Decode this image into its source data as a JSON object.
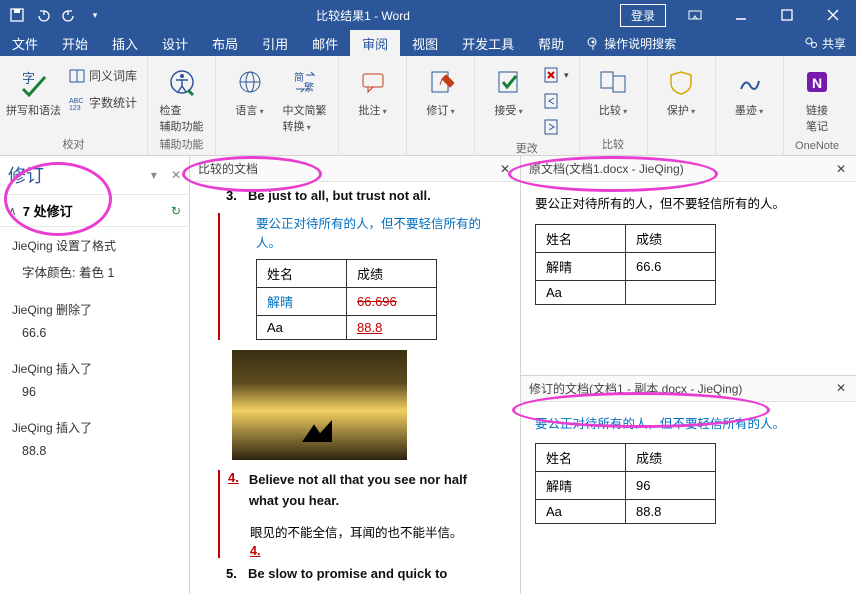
{
  "titlebar": {
    "title": "比较结果1 - Word",
    "login": "登录"
  },
  "menu": {
    "file": "文件",
    "home": "开始",
    "insert": "插入",
    "design": "设计",
    "layout": "布局",
    "references": "引用",
    "mailings": "邮件",
    "review": "审阅",
    "view": "视图",
    "developer": "开发工具",
    "help": "帮助",
    "tellme": "操作说明搜索",
    "share": "共享"
  },
  "ribbon": {
    "proofing": {
      "spell": "拼写和语法",
      "thesaurus": "同义词库",
      "wordcount": "字数统计",
      "label": "校对"
    },
    "accessibility": {
      "check": "检查\n辅助功能",
      "label": "辅助功能"
    },
    "language": {
      "lang": "语言",
      "convert": "中文简繁\n转换",
      "label": ""
    },
    "comments": {
      "comment": "批注",
      "label": ""
    },
    "tracking": {
      "track": "修订",
      "label": ""
    },
    "changes": {
      "accept": "接受",
      "label": "更改"
    },
    "compare": {
      "compare": "比较",
      "label": "比较"
    },
    "protect": {
      "protect": "保护",
      "label": ""
    },
    "ink": {
      "ink": "墨迹",
      "label": ""
    },
    "onenote": {
      "link": "链接\n笔记",
      "label": "OneNote"
    }
  },
  "revpane": {
    "title": "修订",
    "count_label": "7 处修订",
    "entries": [
      {
        "who": "JieQing 设置了格式",
        "what": "字体颜色: 着色 1"
      },
      {
        "who": "JieQing 删除了",
        "what": "66.6"
      },
      {
        "who": "JieQing 插入了",
        "what": "96"
      },
      {
        "who": "JieQing 插入了",
        "what": "88.8"
      }
    ]
  },
  "center": {
    "title": "比较的文档",
    "item3": {
      "num": "3.",
      "heading": "Be just to all, but trust not all.",
      "line": "要公正对待所有的人，但不要轻信所有的人。",
      "table": {
        "h1": "姓名",
        "h2": "成绩",
        "r1c1": "解晴",
        "r1c2": "66.696",
        "r2c1": "Aa",
        "r2c2": "88.8"
      }
    },
    "item4": {
      "num": "4.",
      "heading": "Believe not all that you see nor half what you hear.",
      "line": "眼见的不能全信，耳闻的也不能半信。",
      "marker": "4."
    },
    "item5": {
      "num": "5.",
      "heading": "Be slow to promise and quick to"
    }
  },
  "right_top": {
    "title": "原文档(文档1.docx - JieQing)",
    "line": "要公正对待所有的人，但不要轻信所有的人。",
    "table": {
      "h1": "姓名",
      "h2": "成绩",
      "r1c1": "解晴",
      "r1c2": "66.6",
      "r2c1": "Aa",
      "r2c2": ""
    }
  },
  "right_bottom": {
    "title": "修订的文档(文档1 - 副本.docx - JieQing)",
    "line": "要公正对待所有的人，但不要轻信所有的人。",
    "table": {
      "h1": "姓名",
      "h2": "成绩",
      "r1c1": "解晴",
      "r1c2": "96",
      "r2c1": "Aa",
      "r2c2": "88.8"
    }
  }
}
